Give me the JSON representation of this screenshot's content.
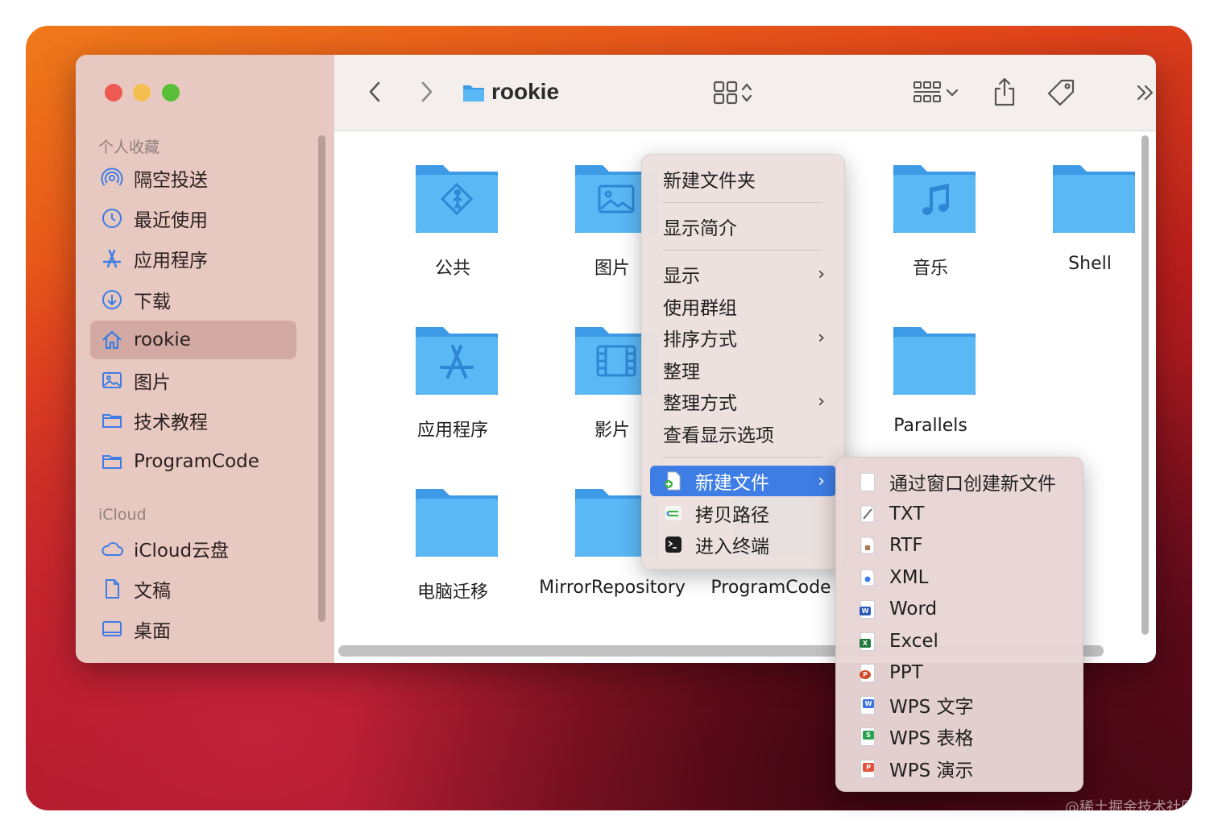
{
  "watermark": "@稀土掘金技术社区",
  "window": {
    "title": "rookie"
  },
  "sidebar": {
    "favorites_header": "个人收藏",
    "icloud_header": "iCloud",
    "favorites": [
      {
        "label": "隔空投送",
        "icon": "airdrop-icon"
      },
      {
        "label": "最近使用",
        "icon": "clock-icon"
      },
      {
        "label": "应用程序",
        "icon": "apps-icon"
      },
      {
        "label": "下载",
        "icon": "download-icon"
      },
      {
        "label": "rookie",
        "icon": "home-icon",
        "active": true
      },
      {
        "label": "图片",
        "icon": "photo-icon"
      },
      {
        "label": "技术教程",
        "icon": "folder-icon"
      },
      {
        "label": "ProgramCode",
        "icon": "folder-icon"
      }
    ],
    "icloud": [
      {
        "label": "iCloud云盘",
        "icon": "cloud-icon"
      },
      {
        "label": "文稿",
        "icon": "document-icon"
      },
      {
        "label": "桌面",
        "icon": "desktop-icon"
      }
    ]
  },
  "folders": [
    {
      "name": "公共",
      "icon": "public-folder-icon"
    },
    {
      "name": "图片",
      "icon": "pictures-folder-icon"
    },
    {
      "name": "音乐",
      "icon": "music-folder-icon"
    },
    {
      "name": "Shell",
      "icon": "folder-icon"
    },
    {
      "name": "应用程序",
      "icon": "applications-folder-icon"
    },
    {
      "name": "影片",
      "icon": "movies-folder-icon"
    },
    {
      "name": "Parallels",
      "icon": "folder-icon"
    },
    {
      "name": "电脑迁移",
      "icon": "folder-icon"
    },
    {
      "name": "MirrorRepository",
      "icon": "folder-icon"
    },
    {
      "name": "ProgramCode",
      "icon": "folder-icon"
    }
  ],
  "context_menu": {
    "items": [
      {
        "label": "新建文件夹"
      },
      {
        "label": "显示简介"
      },
      {
        "label": "显示",
        "submenu": true
      },
      {
        "label": "使用群组"
      },
      {
        "label": "排序方式",
        "submenu": true
      },
      {
        "label": "整理"
      },
      {
        "label": "整理方式",
        "submenu": true
      },
      {
        "label": "查看显示选项"
      },
      {
        "label": "新建文件",
        "submenu": true,
        "highlighted": true,
        "icon": "new-file-icon"
      },
      {
        "label": "拷贝路径",
        "icon": "copy-path-icon"
      },
      {
        "label": "进入终端",
        "icon": "terminal-icon"
      }
    ],
    "arrow": "›"
  },
  "submenu": {
    "items": [
      {
        "label": "通过窗口创建新文件",
        "icon": "blank-file-icon"
      },
      {
        "label": "TXT",
        "icon": "txt-file-icon"
      },
      {
        "label": "RTF",
        "icon": "rtf-file-icon"
      },
      {
        "label": "XML",
        "icon": "xml-file-icon"
      },
      {
        "label": "Word",
        "icon": "word-file-icon",
        "badge": "W",
        "color": "#2b5bb8"
      },
      {
        "label": "Excel",
        "icon": "excel-file-icon",
        "badge": "X",
        "color": "#1f7a3e"
      },
      {
        "label": "PPT",
        "icon": "ppt-file-icon",
        "badge": "P",
        "color": "#d24726"
      },
      {
        "label": "WPS 文字",
        "icon": "wps-writer-icon",
        "badge": "W",
        "color": "#3b73e0"
      },
      {
        "label": "WPS 表格",
        "icon": "wps-sheet-icon",
        "badge": "S",
        "color": "#2aa152"
      },
      {
        "label": "WPS 演示",
        "icon": "wps-presentation-icon",
        "badge": "P",
        "color": "#e3533b"
      }
    ]
  },
  "colors": {
    "accent": "#3d7de4",
    "folder": "#5ab8f5",
    "folder_dark": "#3d9ae6"
  }
}
